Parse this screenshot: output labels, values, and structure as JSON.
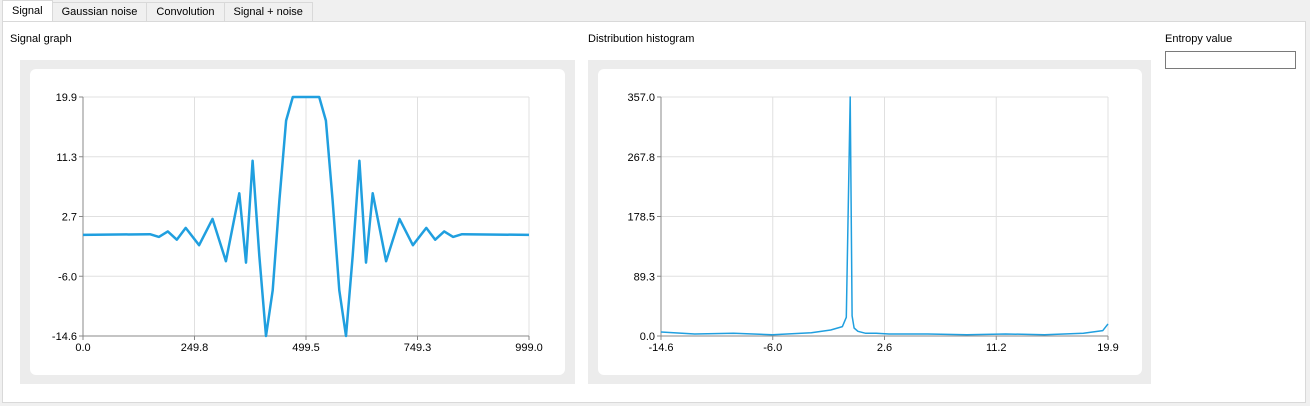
{
  "tabs": [
    {
      "label": "Signal",
      "active": true
    },
    {
      "label": "Gaussian noise",
      "active": false
    },
    {
      "label": "Convolution",
      "active": false
    },
    {
      "label": "Signal + noise",
      "active": false
    }
  ],
  "signal_section": {
    "title": "Signal graph"
  },
  "histogram_section": {
    "title": "Distribution histogram"
  },
  "entropy": {
    "label": "Entropy value",
    "value": ""
  },
  "colors": {
    "series": "#209fdf",
    "grid": "#e0e0e0",
    "frame": "#ececec"
  },
  "chart_data": [
    {
      "type": "line",
      "title": "",
      "xlabel": "",
      "ylabel": "",
      "xlim": [
        0.0,
        999.0
      ],
      "ylim": [
        -14.6,
        19.9
      ],
      "x_ticks": [
        "0.0",
        "249.8",
        "499.5",
        "749.3",
        "999.0"
      ],
      "y_ticks": [
        "19.9",
        "11.3",
        "2.7",
        "-6.0",
        "-14.6"
      ],
      "grid": true,
      "series": [
        {
          "x": [
            0,
            150,
            170,
            190,
            210,
            230,
            260,
            290,
            320,
            350,
            365,
            380,
            395,
            410,
            425,
            440,
            455,
            470,
            485,
            499.5,
            514,
            529,
            544,
            559,
            574,
            589,
            604,
            619,
            634,
            649,
            679,
            709,
            739,
            769,
            789,
            809,
            829,
            849,
            999
          ],
          "y": [
            0.0,
            0.1,
            -0.3,
            0.5,
            -0.7,
            1.0,
            -1.5,
            2.3,
            -3.8,
            6.0,
            -4.0,
            10.7,
            -3.0,
            -14.6,
            -8.0,
            5.0,
            16.5,
            19.9,
            19.9,
            19.9,
            19.9,
            19.9,
            16.5,
            5.0,
            -8.0,
            -14.6,
            -3.0,
            10.7,
            -4.0,
            6.0,
            -3.8,
            2.3,
            -1.5,
            1.0,
            -0.7,
            0.5,
            -0.3,
            0.1,
            0.0
          ]
        }
      ]
    },
    {
      "type": "line",
      "title": "",
      "xlabel": "",
      "ylabel": "",
      "xlim": [
        -14.6,
        19.9
      ],
      "ylim": [
        0.0,
        357.0
      ],
      "x_ticks": [
        "-14.6",
        "-6.0",
        "2.6",
        "11.2",
        "19.9"
      ],
      "y_ticks": [
        "357.0",
        "267.8",
        "178.5",
        "89.3",
        "0.0"
      ],
      "grid": true,
      "series": [
        {
          "x": [
            -14.6,
            -12.0,
            -9.0,
            -6.0,
            -3.0,
            -1.5,
            -0.6,
            -0.3,
            0.0,
            0.15,
            0.3,
            0.6,
            1.2,
            2.0,
            3.0,
            6.0,
            9.0,
            12.0,
            15.0,
            18.0,
            19.5,
            19.9
          ],
          "y": [
            6,
            3,
            4,
            2,
            5,
            9,
            14,
            28,
            357,
            30,
            12,
            7,
            4,
            4,
            3,
            3,
            2,
            3,
            2,
            4,
            8,
            18
          ]
        }
      ]
    }
  ]
}
